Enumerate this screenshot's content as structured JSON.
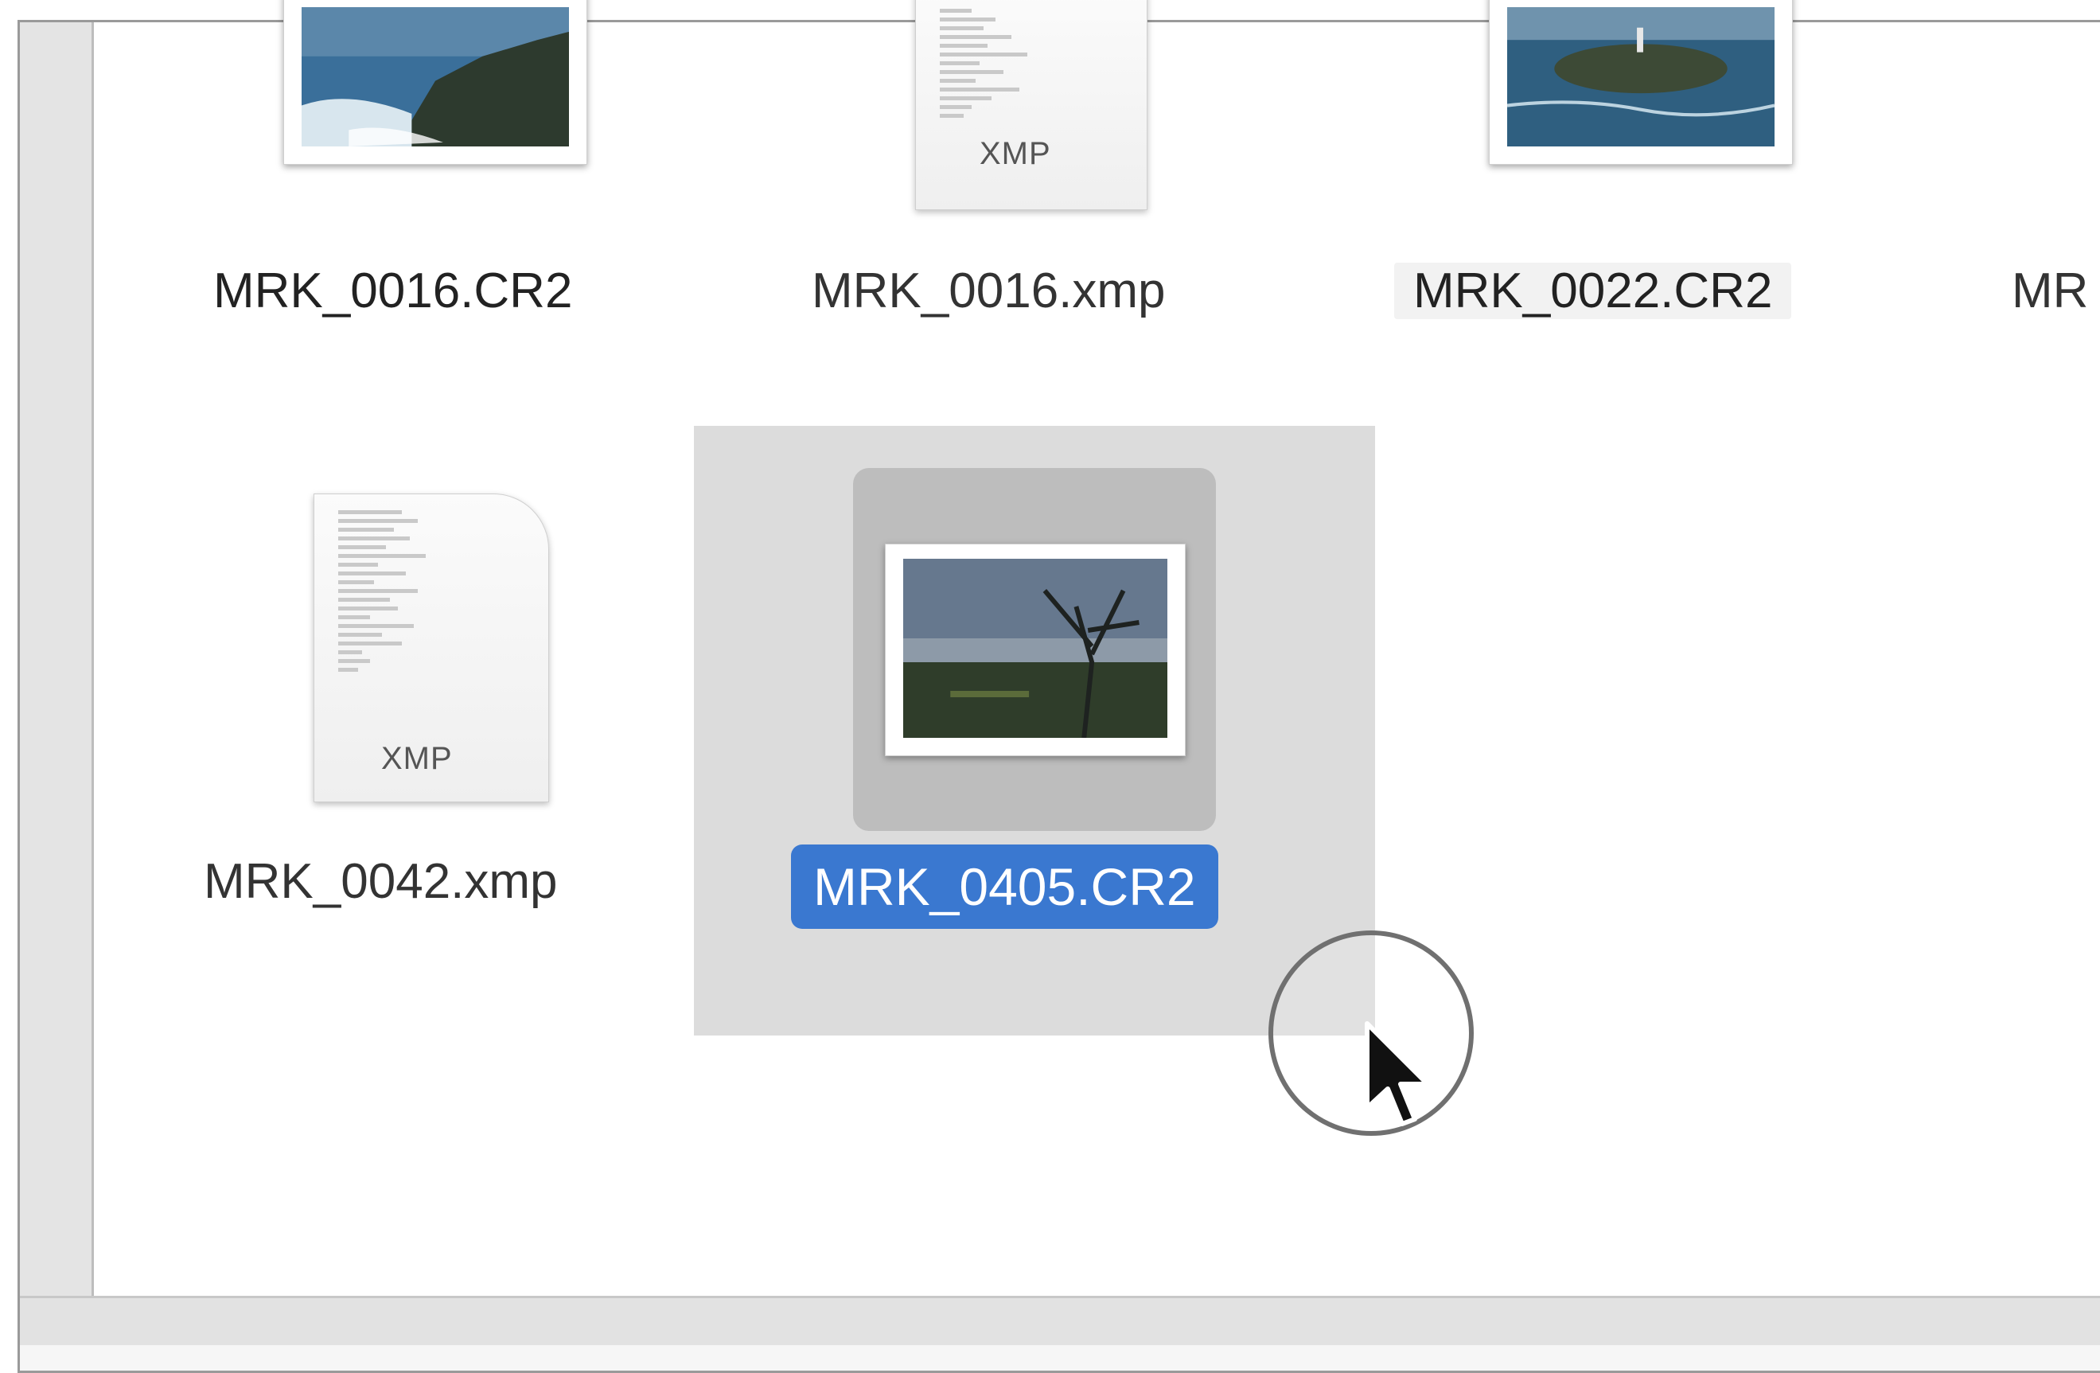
{
  "files": [
    {
      "name": "MRK_0016.CR2",
      "type": "raw-image"
    },
    {
      "name": "MRK_0016.xmp",
      "type": "xmp-sidecar",
      "ext_label": "XMP"
    },
    {
      "name": "MRK_0022.CR2",
      "type": "raw-image"
    },
    {
      "name": "MR",
      "type": "partial"
    },
    {
      "name": "MRK_0042.xmp",
      "type": "xmp-sidecar",
      "ext_label": "XMP"
    },
    {
      "name": "MRK_0405.CR2",
      "type": "raw-image",
      "selected": true
    }
  ],
  "colors": {
    "selection_label": "#3a78d0",
    "selection_box": "#dcdcdc",
    "icon_selected_bg": "#bdbdbd"
  },
  "icons": [
    "image-thumbnail-icon",
    "xmp-document-icon",
    "cursor-arrow-icon"
  ]
}
